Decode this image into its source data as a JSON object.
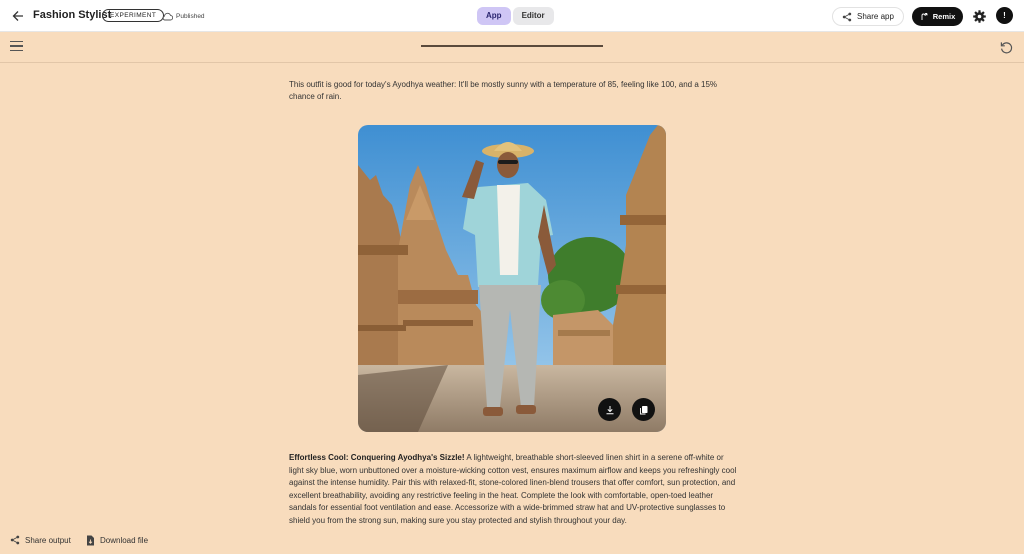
{
  "header": {
    "title": "Fashion Stylist",
    "badge": "EXPERIMENT",
    "status": "Published",
    "tabs": [
      {
        "label": "App",
        "active": true
      },
      {
        "label": "Editor",
        "active": false
      }
    ],
    "share_label": "Share app",
    "remix_label": "Remix",
    "avatar_initial": "!"
  },
  "progress": {
    "value": 1.0
  },
  "content": {
    "weather_text": "This outfit is good for today's Ayodhya weather: It'll be mostly sunny with a temperature of 85, feeling like 100, and a 15% chance of rain.",
    "description_title": "Effortless Cool: Conquering Ayodhya's Sizzle!",
    "description_body": " A lightweight, breathable short-sleeved linen shirt in a serene off-white or light sky blue, worn unbuttoned over a moisture-wicking cotton vest, ensures maximum airflow and keeps you refreshingly cool against the intense humidity. Pair this with relaxed-fit, stone-colored linen-blend trousers that offer comfort, sun protection, and excellent breathability, avoiding any restrictive feeling in the heat. Complete the look with comfortable, open-toed leather sandals for essential foot ventilation and ease. Accessorize with a wide-brimmed straw hat and UV-protective sunglasses to shield you from the strong sun, making sure you stay protected and stylish throughout your day."
  },
  "footer": {
    "share_output": "Share output",
    "download_file": "Download file"
  },
  "colors": {
    "background": "#f8dcbd",
    "active_tab": "#cfc6f5",
    "remix_bg": "#111111"
  }
}
